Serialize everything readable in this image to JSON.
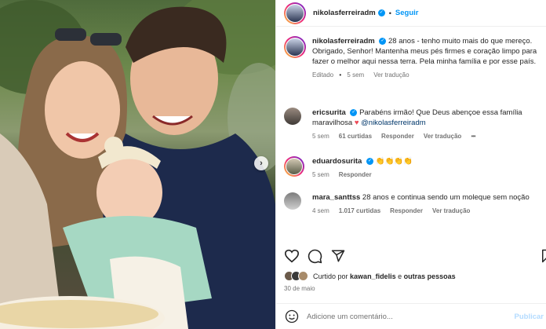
{
  "post": {
    "username": "nikolasferreiradm",
    "follow_label": "Seguir",
    "separator": "•",
    "next_icon": "chevron-right-icon"
  },
  "caption": {
    "username": "nikolasferreiradm",
    "text": "28 anos - tenho muito mais do que mereço. Obrigado, Senhor! Mantenha meus pés firmes e coração limpo para fazer o melhor aqui nessa terra. Pela minha família e por esse país.",
    "edited": "Editado",
    "time": "5 sem",
    "translation": "Ver tradução"
  },
  "comments": [
    {
      "username": "ericsurita",
      "verified": true,
      "text": "Parabéns irmão! Que Deus abençoe essa família maravilhosa",
      "heart": "♥",
      "mention": "@nikolasferreiradm",
      "time": "5 sem",
      "likes": "61 curtidas",
      "reply": "Responder",
      "translation": "Ver tradução",
      "more": "•••"
    },
    {
      "username": "eduardosurita",
      "verified": true,
      "text": "👏👏👏👏",
      "time": "5 sem",
      "reply": "Responder"
    },
    {
      "username": "mara_santtss",
      "verified": false,
      "text": "28 anos e continua sendo um moleque sem noção",
      "time": "4 sem",
      "likes": "1.017 curtidas",
      "reply": "Responder",
      "translation": "Ver tradução"
    }
  ],
  "likes_line": {
    "prefix": "Curtido por",
    "user": "kawan_fidelis",
    "conj": "e",
    "others": "outras pessoas"
  },
  "date": "30 de maio",
  "add_comment": {
    "placeholder": "Adicione um comentário...",
    "publish": "Publicar"
  },
  "colors": {
    "link_blue": "#0095f6",
    "verified_blue": "#0095f6",
    "muted": "#737373",
    "heart": "#ed4956"
  }
}
